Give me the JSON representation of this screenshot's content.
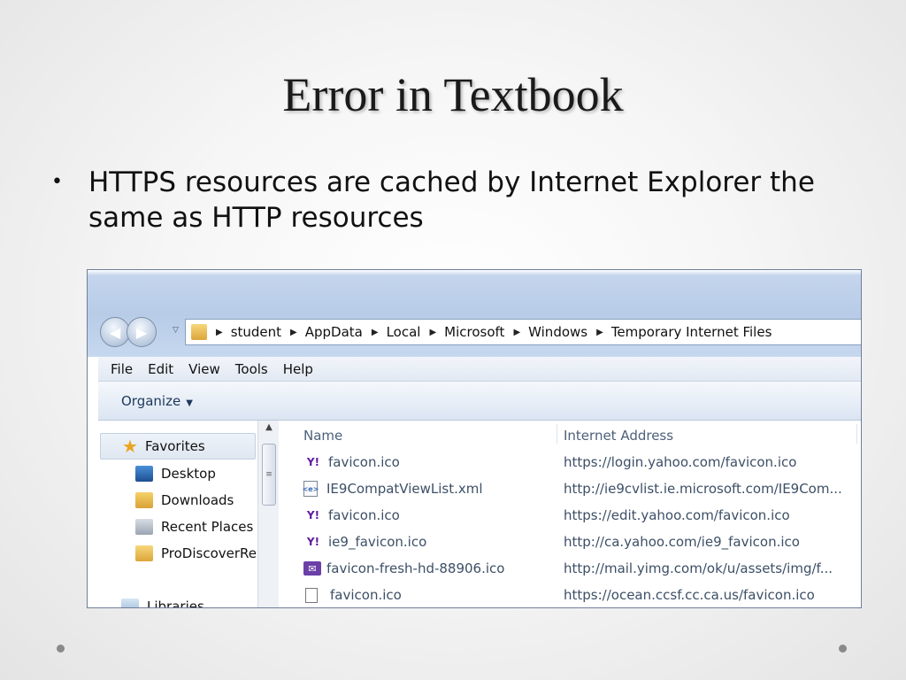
{
  "slide": {
    "title": "Error in Textbook",
    "bullet": "HTTPS resources are cached by Internet Explorer the same as HTTP resources"
  },
  "explorer": {
    "breadcrumbs": [
      "student",
      "AppData",
      "Local",
      "Microsoft",
      "Windows",
      "Temporary Internet Files"
    ],
    "menu": [
      "File",
      "Edit",
      "View",
      "Tools",
      "Help"
    ],
    "toolbar": {
      "organize_label": "Organize"
    },
    "nav": {
      "favorites": "Favorites",
      "items": [
        "Desktop",
        "Downloads",
        "Recent Places",
        "ProDiscoverRe"
      ],
      "libraries": "Libraries"
    },
    "columns": {
      "name": "Name",
      "address": "Internet Address"
    },
    "files": [
      {
        "name": "favicon.ico",
        "address": "https://login.yahoo.com/favicon.ico",
        "icon": "yahoo-icon"
      },
      {
        "name": "IE9CompatViewList.xml",
        "address": "http://ie9cvlist.ie.microsoft.com/IE9Com...",
        "icon": "xml-file-icon"
      },
      {
        "name": "favicon.ico",
        "address": "https://edit.yahoo.com/favicon.ico",
        "icon": "yahoo-icon"
      },
      {
        "name": "ie9_favicon.ico",
        "address": "http://ca.yahoo.com/ie9_favicon.ico",
        "icon": "yahoo-icon"
      },
      {
        "name": "favicon-fresh-hd-88906.ico",
        "address": "http://mail.yimg.com/ok/u/assets/img/f...",
        "icon": "mail-icon"
      },
      {
        "name": "favicon.ico",
        "address": "https://ocean.ccsf.cc.ca.us/favicon.ico",
        "icon": "file-icon"
      }
    ]
  }
}
